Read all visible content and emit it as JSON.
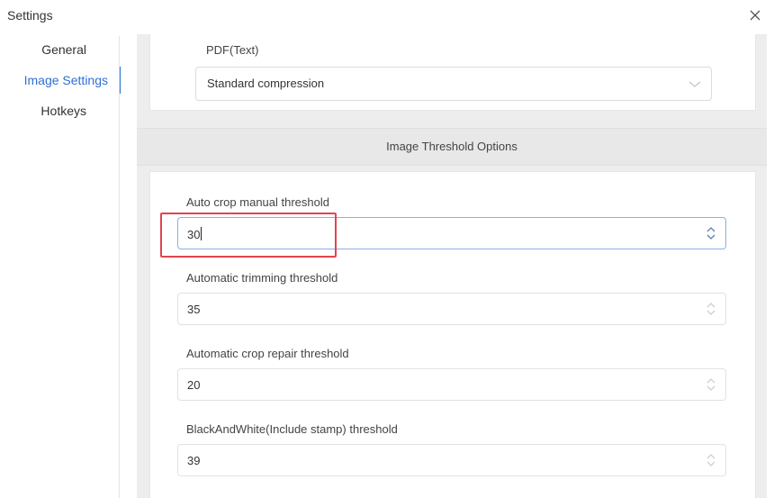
{
  "window": {
    "title": "Settings",
    "close_icon": "close-icon"
  },
  "sidebar": {
    "items": [
      {
        "label": "General",
        "active": false
      },
      {
        "label": "Image Settings",
        "active": true
      },
      {
        "label": "Hotkeys",
        "active": false
      }
    ]
  },
  "pdf_section": {
    "label": "PDF(Text)",
    "selected_value": "Standard compression",
    "chevron_icon": "chevron-down-icon"
  },
  "threshold_section": {
    "title": "Image Threshold Options",
    "fields": [
      {
        "label": "Auto crop manual threshold",
        "value": "30",
        "focused": true
      },
      {
        "label": "Automatic trimming threshold",
        "value": "35",
        "focused": false
      },
      {
        "label": "Automatic crop repair threshold",
        "value": "20",
        "focused": false
      },
      {
        "label": "BlackAndWhite(Include stamp) threshold",
        "value": "39",
        "focused": false
      }
    ],
    "stepper_icon": "stepper-updown-icon"
  },
  "annotation": {
    "highlight_color": "#e0454f"
  },
  "colors": {
    "accent": "#2f6fd3",
    "panel_bg": "#ededed",
    "card_bg": "#ffffff"
  }
}
